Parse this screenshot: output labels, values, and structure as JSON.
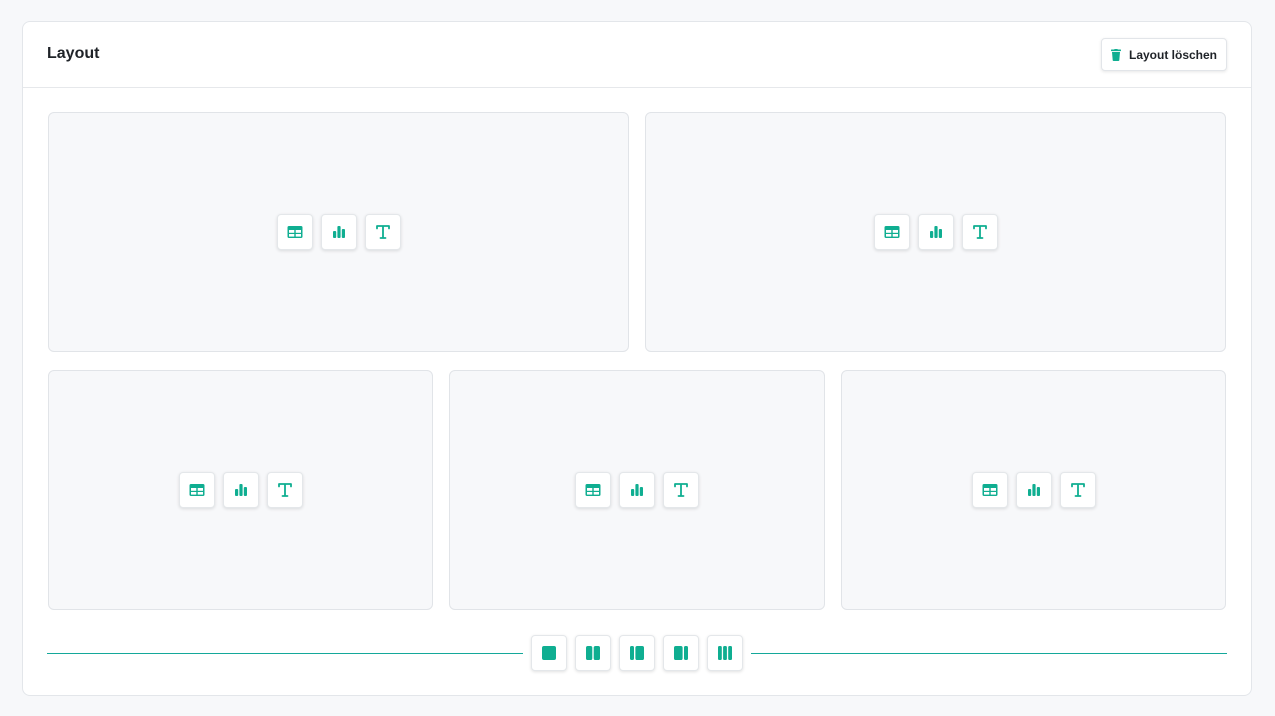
{
  "header": {
    "title": "Layout",
    "clear_button_label": "Layout löschen",
    "clear_button_icon": "trash-icon"
  },
  "zone_tools": [
    {
      "name": "insert-table-button",
      "icon": "table-icon"
    },
    {
      "name": "insert-chart-button",
      "icon": "bar-chart-icon"
    },
    {
      "name": "insert-text-button",
      "icon": "text-icon"
    }
  ],
  "rows": [
    {
      "columns": 2
    },
    {
      "columns": 3
    }
  ],
  "layout_options": [
    {
      "name": "layout-single-column",
      "icon": "layout-1-col-icon"
    },
    {
      "name": "layout-two-columns",
      "icon": "layout-2-col-icon"
    },
    {
      "name": "layout-left-narrow",
      "icon": "layout-left-narrow-icon"
    },
    {
      "name": "layout-right-narrow",
      "icon": "layout-right-narrow-icon"
    },
    {
      "name": "layout-three-columns",
      "icon": "layout-3-col-icon"
    }
  ],
  "colors": {
    "accent": "#14a89a",
    "icon": "#0fae91",
    "zone_bg": "#f7f8fa",
    "border": "#e1e4e8"
  }
}
